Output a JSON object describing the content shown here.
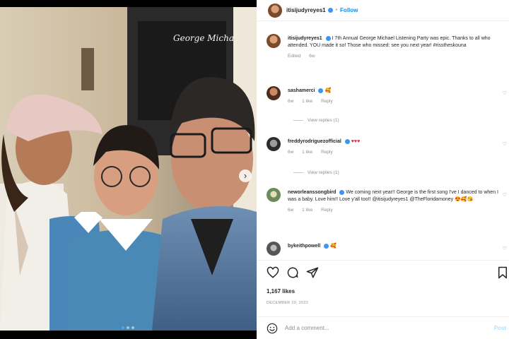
{
  "post": {
    "username": "itisijudyreyes1",
    "follow_label": "Follow",
    "separator": "•"
  },
  "photo": {
    "neon_sign": "George Michael",
    "next_glyph": "›"
  },
  "caption": {
    "username": "itisijudyreyes1",
    "text": "I 7th Annual George Michael Listening Party was epic. Thanks to all who attended. YOU made it so! Those who missed: see you next year! #risstheskouna",
    "meta_edited": "Edited",
    "meta_time": "6w"
  },
  "comments": [
    {
      "username": "sashamerci",
      "text": "",
      "time": "6w",
      "likes": "1 like",
      "reply": "Reply",
      "view_replies": "View replies (1)"
    },
    {
      "username": "freddyrodriguezofficial",
      "text": "♥♥♥",
      "time": "6w",
      "likes": "1 like",
      "reply": "Reply",
      "view_replies": "View replies (1)"
    },
    {
      "username": "neworleanssongbird",
      "text": "We coming next year!! George is the first song I've I danced to when I was a baby. Love him!! Love y'all too!! @itisijudyreyes1 @TheFloridamoney",
      "time": "6w",
      "likes": "1 like",
      "reply": "Reply"
    },
    {
      "username": "bykeithpowell",
      "text": ""
    }
  ],
  "likes": "1,167 likes",
  "date": "DECEMBER 20, 2022",
  "add_comment": {
    "placeholder": "Add a comment...",
    "post_label": "Post"
  },
  "colors": {
    "accent": "#0095f6",
    "verified": "#3897f0",
    "heart_red": "#d6212f"
  },
  "icons": {
    "like": "heart-icon",
    "comment": "comment-icon",
    "share": "paper-plane-icon",
    "save": "bookmark-icon",
    "emoji": "smiley-icon"
  }
}
